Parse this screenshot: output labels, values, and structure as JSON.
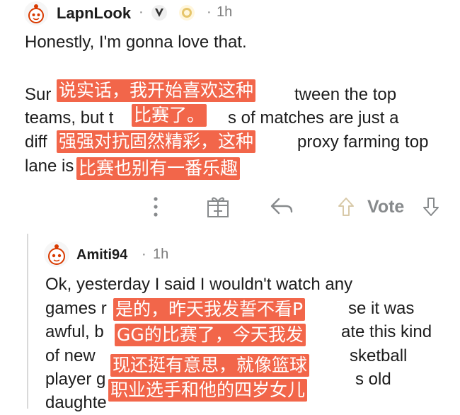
{
  "comment1": {
    "username": "LapnLook",
    "separator": "·",
    "time": "1h",
    "line1": "Honestly, I'm gonna love that.",
    "line2": "Sur",
    "line2b": "tween the top",
    "line3": "teams, but t",
    "line3b": "s of matches are just a",
    "line4": "diff",
    "line4b": "proxy farming top",
    "line5": "lane is",
    "vote_label": "Vote"
  },
  "comment2": {
    "username": "Amiti94",
    "separator": "·",
    "time": "1h",
    "line1": "Ok, yesterday I said I wouldn't watch any",
    "line2": "games r",
    "line2b": "se it was",
    "line3": "awful, b",
    "line3b": "ate this kind",
    "line4": "of new",
    "line4b": "sketball",
    "line5": "player g",
    "line5b": "s old",
    "line6": "daughte"
  },
  "overlays": [
    "说实话，我开始喜欢这种",
    "比赛了。",
    "强强对抗固然精彩，这种",
    "比赛也别有一番乐趣",
    "是的，昨天我发誓不看P",
    "GG的比赛了，今天我发",
    "现还挺有意思，就像篮球",
    "职业选手和他的四岁女儿"
  ],
  "colors": {
    "overlay": "#f2664a",
    "meta": "#7c7c7c",
    "text": "#1c1c1c",
    "icons": "#878a8c"
  }
}
